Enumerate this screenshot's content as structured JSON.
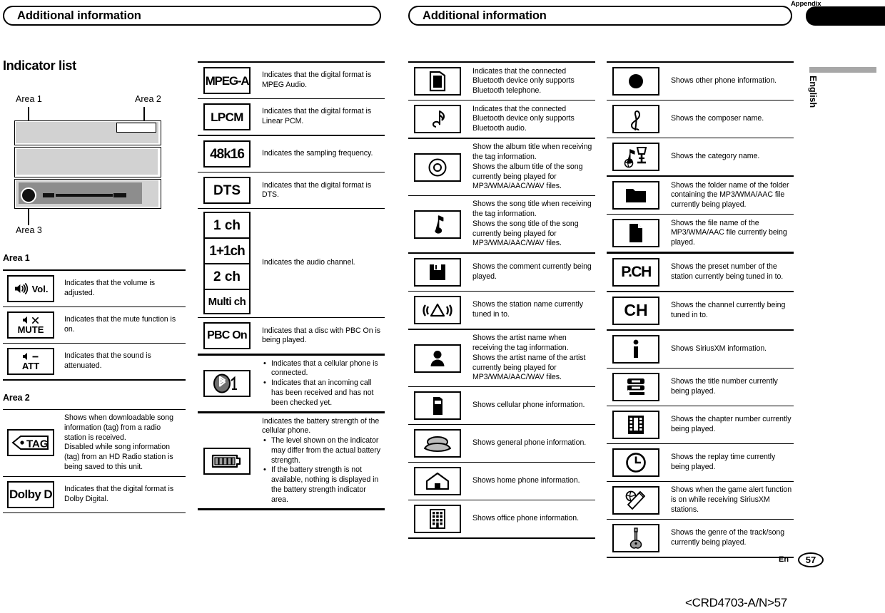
{
  "header": {
    "left_title": "Additional information",
    "right_title": "Additional information",
    "appendix_tab": "Appendix",
    "language_tab": "English"
  },
  "left_column": {
    "section_title": "Indicator list",
    "diagram": {
      "label_area1": "Area 1",
      "label_area2": "Area 2",
      "label_area3": "Area 3"
    },
    "area1_title": "Area 1",
    "area1_rows": [
      {
        "icon": "speaker-volume-icon",
        "icon_text": "Vol.",
        "desc": "Indicates that the volume is adjusted."
      },
      {
        "icon": "speaker-mute-icon",
        "icon_text": "MUTE",
        "desc": "Indicates that the mute function is on."
      },
      {
        "icon": "speaker-attenuate-icon",
        "icon_text": "ATT",
        "desc": "Indicates that the sound is attenuated."
      }
    ],
    "area2_title": "Area 2",
    "area2_rows": [
      {
        "icon": "tag-icon",
        "icon_text": "TAG",
        "desc1": "Shows when downloadable song information (tag) from a radio station is received.",
        "desc2": "Disabled while song information (tag) from an HD Radio station is being saved to this unit."
      },
      {
        "icon": "dolby-digital-icon",
        "icon_text": "Dolby D",
        "desc": "Indicates that the digital format is Dolby Digital."
      }
    ]
  },
  "column2": {
    "rows": [
      {
        "icon": "mpeg-a-icon",
        "label": "MPEG-A",
        "desc": "Indicates that the digital format is MPEG Audio."
      },
      {
        "icon": "lpcm-icon",
        "label": "LPCM",
        "desc": "Indicates that the digital format is Linear PCM."
      },
      {
        "icon": "48k16-icon",
        "label": "48k16",
        "desc": "Indicates the sampling frequency."
      },
      {
        "icon": "dts-icon",
        "label": "DTS",
        "desc": "Indicates that the digital format is DTS."
      }
    ],
    "channel_group": {
      "labels": [
        "1 ch",
        "1+1ch",
        "2 ch",
        "Multi ch"
      ],
      "desc": "Indicates the audio channel."
    },
    "pbc": {
      "icon": "pbc-on-icon",
      "label": "PBC On",
      "desc": "Indicates that a disc with PBC On is being played."
    },
    "bluetooth": {
      "icon": "bluetooth-phone-icon",
      "bullets": [
        "Indicates that a cellular phone is connected.",
        "Indicates that an incoming call has been received and has not been checked yet."
      ]
    },
    "battery": {
      "icon": "battery-strength-icon",
      "intro": "Indicates the battery strength of the cellular phone.",
      "bullets": [
        "The level shown on the indicator may differ from the actual battery strength.",
        "If the battery strength is not available, nothing is displayed in the battery strength indicator area."
      ]
    }
  },
  "column3": {
    "rows": [
      {
        "icon": "bluetooth-telephone-device-icon",
        "desc": "Indicates that the connected Bluetooth device only supports Bluetooth telephone."
      },
      {
        "icon": "bluetooth-audio-device-icon",
        "desc": "Indicates that the connected Bluetooth device only supports Bluetooth audio."
      },
      {
        "icon": "album-disc-icon",
        "desc": "Show the album title when receiving the tag information.\nShows the album title of the song currently being played for MP3/WMA/AAC/WAV files."
      },
      {
        "icon": "song-note-icon",
        "desc": "Shows the song title when receiving the tag information.\nShows the song title of the song currently being played for MP3/WMA/AAC/WAV files."
      },
      {
        "icon": "comment-floppy-icon",
        "desc": "Shows the comment currently being played."
      },
      {
        "icon": "station-broadcast-icon",
        "desc": "Shows the station name currently tuned in to."
      },
      {
        "icon": "artist-person-icon",
        "desc": "Shows the artist name when receiving the tag information.\nShows the artist name of the artist currently being played for MP3/WMA/AAC/WAV files."
      },
      {
        "icon": "cellular-phone-icon",
        "desc": "Shows cellular phone information."
      },
      {
        "icon": "general-phone-icon",
        "desc": "Shows general phone information."
      },
      {
        "icon": "home-phone-icon",
        "desc": "Shows home phone information."
      },
      {
        "icon": "office-phone-icon",
        "desc": "Shows office phone information."
      }
    ]
  },
  "column4": {
    "rows": [
      {
        "icon": "other-phone-dot-icon",
        "desc": "Shows other phone information."
      },
      {
        "icon": "composer-clef-icon",
        "desc": "Shows the composer name."
      },
      {
        "icon": "category-icon",
        "desc": "Shows the category name."
      },
      {
        "icon": "folder-icon",
        "desc": "Shows the folder name of the folder containing the MP3/WMA/AAC file currently being played."
      },
      {
        "icon": "file-icon",
        "desc": "Shows the file name of the MP3/WMA/AAC file currently being played."
      },
      {
        "icon": "preset-channel-icon",
        "label": "P.CH",
        "desc": "Shows the preset number of the station currently being tuned in to."
      },
      {
        "icon": "channel-icon",
        "label": "CH",
        "desc": "Shows the channel currently being tuned in to."
      },
      {
        "icon": "information-icon",
        "desc": "Shows SiriusXM information."
      },
      {
        "icon": "title-number-icon",
        "desc": "Shows the title number currently being played."
      },
      {
        "icon": "chapter-film-icon",
        "desc": "Shows the chapter number currently being played."
      },
      {
        "icon": "replay-clock-icon",
        "desc": "Shows the replay time currently being played."
      },
      {
        "icon": "game-alert-icon",
        "desc": "Shows when the game alert function is on while receiving SiriusXM stations."
      },
      {
        "icon": "genre-guitar-icon",
        "desc": "Shows the genre of the track/song currently being played."
      }
    ]
  },
  "footer": {
    "language_code": "En",
    "page_number": "57",
    "doc_code": "<CRD4703-A/N>57"
  }
}
